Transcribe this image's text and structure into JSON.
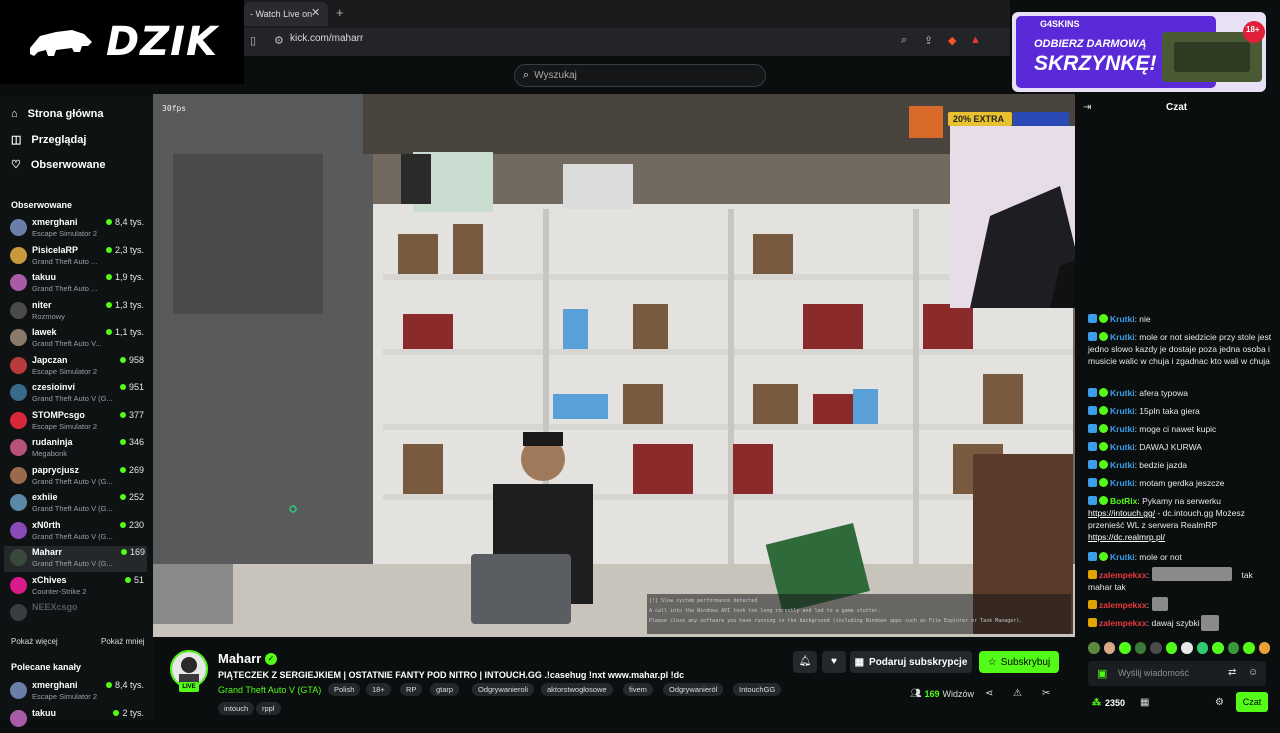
{
  "overlay_logo": {
    "text": "DZIK"
  },
  "browser": {
    "tab_title": "- Watch Live on",
    "url": "kick.com/maharr"
  },
  "search": {
    "placeholder": "Wyszukaj"
  },
  "nav": [
    {
      "label": "Strona główna",
      "icon": "home-icon"
    },
    {
      "label": "Przeglądaj",
      "icon": "compass-icon"
    },
    {
      "label": "Obserwowane",
      "icon": "heart-icon"
    }
  ],
  "followed_header": "Obserwowane",
  "followed": [
    {
      "name": "xmerghani",
      "game": "Escape Simulator 2",
      "viewers": "8,4 tys.",
      "color": "#6a7ea8"
    },
    {
      "name": "PisicelaRP",
      "game": "Grand Theft Auto ...",
      "viewers": "2,3 tys.",
      "color": "#c89a3c"
    },
    {
      "name": "takuu",
      "game": "Grand Theft Auto ...",
      "viewers": "1,9 tys.",
      "color": "#a85ca8"
    },
    {
      "name": "niter",
      "game": "Rozmowy",
      "viewers": "1,3 tys.",
      "color": "#4a4a4a"
    },
    {
      "name": "lawek",
      "game": "Grand Theft Auto V...",
      "viewers": "1,1 tys.",
      "color": "#8a7a6a"
    },
    {
      "name": "Japczan",
      "game": "Escape Simulator 2",
      "viewers": "958",
      "color": "#b83a3a"
    },
    {
      "name": "czesioinvi",
      "game": "Grand Theft Auto V (G...",
      "viewers": "951",
      "color": "#3a6a8a"
    },
    {
      "name": "STOMPcsgo",
      "game": "Escape Simulator 2",
      "viewers": "377",
      "color": "#d8283a"
    },
    {
      "name": "rudaninja",
      "game": "Megabonk",
      "viewers": "346",
      "color": "#b8527a"
    },
    {
      "name": "paprycjusz",
      "game": "Grand Theft Auto V (G...",
      "viewers": "269",
      "color": "#9a6a4a"
    },
    {
      "name": "exhiie",
      "game": "Grand Theft Auto V (G...",
      "viewers": "252",
      "color": "#5a8aa8"
    },
    {
      "name": "xN0rth",
      "game": "Grand Theft Auto V (G...",
      "viewers": "230",
      "color": "#8a4ab8"
    },
    {
      "name": "Maharr",
      "game": "Grand Theft Auto V (G...",
      "viewers": "169",
      "color": "#3a4a3a"
    },
    {
      "name": "xChives",
      "game": "Counter-Strike 2",
      "viewers": "51",
      "color": "#d81a8a"
    },
    {
      "name": "NEEXcsgo",
      "game": "",
      "viewers": "",
      "color": "#3a3d40"
    }
  ],
  "show_more": "Pokaż więcej",
  "show_less": "Pokaż mniej",
  "recommended_header": "Polecane kanały",
  "recommended": [
    {
      "name": "xmerghani",
      "game": "Escape Simulator 2",
      "viewers": "8,4 tys.",
      "color": "#6a7ea8"
    },
    {
      "name": "takuu",
      "game": "",
      "viewers": "2 tys.",
      "color": "#a85ca8"
    }
  ],
  "video": {
    "fps": "30fps",
    "overlay_extra": "20% EXTRA",
    "console_lines": [
      "[!] Slow system performance detected",
      "A call into the Windows API took too long recently and led to a game stutter.",
      "Please close any software you have running in the background (including Windows apps such as File Explorer or Task Manager)."
    ]
  },
  "promo": {
    "brand": "G4SKINS",
    "line1": "ODBIERZ DARMOWĄ",
    "line2": "SKRZYNKĘ!",
    "age": "18+"
  },
  "chat": {
    "title": "Czat",
    "messages": [
      {
        "user": "Krutki",
        "user_color": "#3b9ee8",
        "badge": "mod",
        "text": "nie"
      },
      {
        "user": "Krutki",
        "user_color": "#3b9ee8",
        "badge": "mod",
        "text": "mole or not siedzicie przy stole jest jedno slowo kazdy je dostaje poza jedna osoba i musicie walic w chuja i zgadnac kto wali w chuja"
      },
      {
        "user": "Krutki",
        "user_color": "#3b9ee8",
        "badge": "mod",
        "text": "afera typowa"
      },
      {
        "user": "Krutki",
        "user_color": "#3b9ee8",
        "badge": "mod",
        "text": "15pln taka giera"
      },
      {
        "user": "Krutki",
        "user_color": "#3b9ee8",
        "badge": "mod",
        "text": "moge ci nawet kupic"
      },
      {
        "user": "Krutki",
        "user_color": "#3b9ee8",
        "badge": "mod",
        "text": "DAWAJ KURWA"
      },
      {
        "user": "Krutki",
        "user_color": "#3b9ee8",
        "badge": "mod",
        "text": "bedzie jazda"
      },
      {
        "user": "Krutki",
        "user_color": "#3b9ee8",
        "badge": "mod",
        "text": "motam gerdka jeszcze"
      },
      {
        "user": "BotRix",
        "user_color": "#53fc18",
        "badge": "mod",
        "text": "Pykamy na serwerku",
        "link1": "https://intouch.gg/",
        "text2": " - dc.intouch.gg Możesz przenieść WL z serwera RealmRP",
        "link2": "https://dc.realmrp.pl/"
      },
      {
        "user": "Krutki",
        "user_color": "#3b9ee8",
        "badge": "mod",
        "text": "mole or not"
      },
      {
        "user": "zalempekxx",
        "user_color": "#e8383a",
        "badge": "gold",
        "text": "tak mahar tak"
      },
      {
        "user": "zalempekxx",
        "user_color": "#e8383a",
        "badge": "gold",
        "text": ""
      },
      {
        "user": "zalempekxx",
        "user_color": "#e8383a",
        "badge": "gold",
        "text": "dawaj szybki"
      }
    ],
    "input_placeholder": "Wyślij wiadomość",
    "points": "2350",
    "send_label": "Czat"
  },
  "stream": {
    "live_label": "LIVE",
    "streamer": "Maharr",
    "title": "PIĄTECZEK Z SERGIEJKIEM | OSTATNIE FANTY POD NITRO | INTOUCH.GG .!casehug !nxt www.mahar.pl !dc",
    "game": "Grand Theft Auto V (GTA)",
    "tags": [
      "Polish",
      "18+",
      "RP",
      "gtarp",
      "Odgrywanieroli",
      "aktorstwogłosowe",
      "fivem",
      "Odgrywanieról",
      "IntouchGG"
    ],
    "tags2": [
      "intouch",
      "rppl"
    ],
    "gift_label": "Podaruj subskrypcje",
    "subscribe_label": "Subskrybuj",
    "viewers": "169",
    "viewers_label": "Widzów"
  },
  "colors": {
    "accent": "#53fc18",
    "background": "#0b0e0f",
    "sidebar": "#0f1213"
  }
}
